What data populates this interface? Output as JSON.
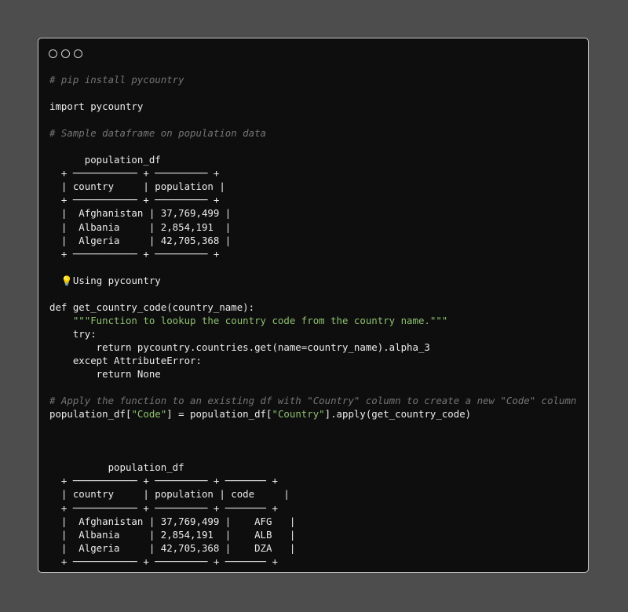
{
  "window": {
    "controls": [
      "circle-icon",
      "circle-icon",
      "circle-icon"
    ],
    "colors": {
      "background": "#0e0e0e",
      "page": "#4d4d4d",
      "text": "#ececec",
      "comment": "#757575",
      "string": "#8ec16f",
      "bulb": "#f2c436"
    }
  },
  "code": {
    "comment_install": "# pip install pycountry",
    "import_line": "import pycountry",
    "comment_sample": "# Sample dataframe on population data",
    "table1": [
      "      population_df",
      "  + ─────────── + ───────── +",
      "  | country     | population |",
      "  + ─────────── + ───────── +",
      "  |  Afghanistan | 37,769,499 |",
      "  |  Albania     | 2,854,191  |",
      "  |  Algeria     | 42,705,368 |",
      "  + ─────────── + ───────── +"
    ],
    "bulb_icon": "lightbulb-icon",
    "using_text": "Using pycountry",
    "def_line": "def get_country_code(country_name):",
    "docstring": "    \"\"\"Function to lookup the country code from the country name.\"\"\"",
    "try_line": "    try:",
    "return_line": "        return pycountry.countries.get(name=country_name).alpha_3",
    "except_line": "    except AttributeError:",
    "return_none": "        return None",
    "comment_apply": "# Apply the function to an existing df with \"Country\" column to create a new \"Code\" column",
    "assign": {
      "p1": "population_df[",
      "s1": "\"Code\"",
      "p2": "] = population_df[",
      "s2": "\"Country\"",
      "p3": "].apply(get_country_code)"
    },
    "table2": [
      "          population_df",
      "  + ─────────── + ───────── + ─────── +",
      "  | country     | population | code     |",
      "  + ─────────── + ───────── + ─────── +",
      "  |  Afghanistan | 37,769,499 |    AFG   |",
      "  |  Albania     | 2,854,191  |    ALB   |",
      "  |  Algeria     | 42,705,368 |    DZA   |",
      "  + ─────────── + ───────── + ─────── +"
    ]
  }
}
